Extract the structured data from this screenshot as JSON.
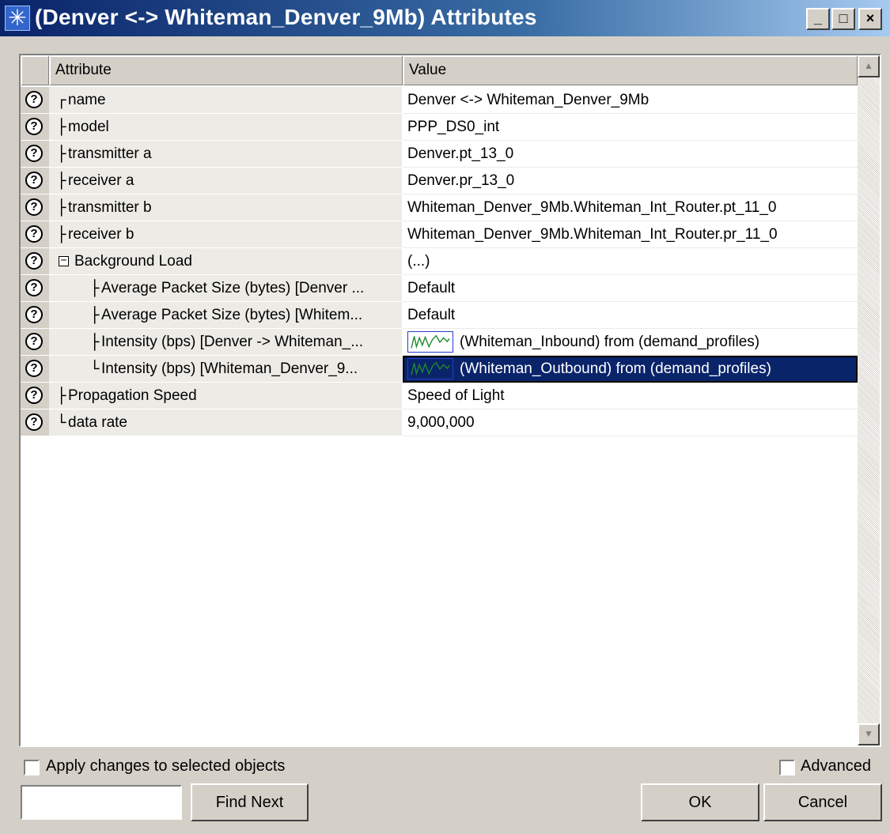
{
  "window": {
    "title": "(Denver <-> Whiteman_Denver_9Mb) Attributes",
    "minimize": "_",
    "maximize": "□",
    "close": "×"
  },
  "table": {
    "headers": {
      "attribute": "Attribute",
      "value": "Value"
    },
    "rows": [
      {
        "tree": "┌",
        "indent": 0,
        "label": "name",
        "value": "Denver <-> Whiteman_Denver_9Mb"
      },
      {
        "tree": "├",
        "indent": 0,
        "label": "model",
        "value": "PPP_DS0_int"
      },
      {
        "tree": "├",
        "indent": 0,
        "label": "transmitter a",
        "value": "Denver.pt_13_0"
      },
      {
        "tree": "├",
        "indent": 0,
        "label": "receiver a",
        "value": "Denver.pr_13_0"
      },
      {
        "tree": "├",
        "indent": 0,
        "label": "transmitter b",
        "value": "Whiteman_Denver_9Mb.Whiteman_Int_Router.pt_11_0"
      },
      {
        "tree": "├",
        "indent": 0,
        "label": "receiver b",
        "value": "Whiteman_Denver_9Mb.Whiteman_Int_Router.pr_11_0"
      },
      {
        "tree": "⊟",
        "indent": 0,
        "label": "Background Load",
        "value": "(...)",
        "expander": true
      },
      {
        "tree": "├",
        "indent": 1,
        "label": "Average Packet Size (bytes) [Denver ...",
        "value": "Default"
      },
      {
        "tree": "├",
        "indent": 1,
        "label": "Average Packet Size (bytes) [Whitem...",
        "value": "Default"
      },
      {
        "tree": "├",
        "indent": 1,
        "label": "Intensity (bps) [Denver -> Whiteman_...",
        "value": "(Whiteman_Inbound) from (demand_profiles)",
        "spark": true
      },
      {
        "tree": "└",
        "indent": 1,
        "label": "Intensity (bps) [Whiteman_Denver_9...",
        "value": "(Whiteman_Outbound) from (demand_profiles)",
        "spark": true,
        "selected": true
      },
      {
        "tree": "├",
        "indent": 0,
        "label": "Propagation Speed",
        "value": "Speed of Light"
      },
      {
        "tree": "└",
        "indent": 0,
        "label": "data rate",
        "value": "9,000,000"
      }
    ]
  },
  "options": {
    "apply_changes": "Apply changes to selected objects",
    "advanced": "Advanced"
  },
  "search": {
    "value": "",
    "placeholder": ""
  },
  "buttons": {
    "find_next": "Find Next",
    "ok": "OK",
    "cancel": "Cancel"
  },
  "colors": {
    "title_gradient_start": "#0a246a",
    "selection": "#0a246a",
    "face": "#d4d0c8",
    "attr_bg": "#ecebe6",
    "sparkline": "#1e8a2e"
  }
}
